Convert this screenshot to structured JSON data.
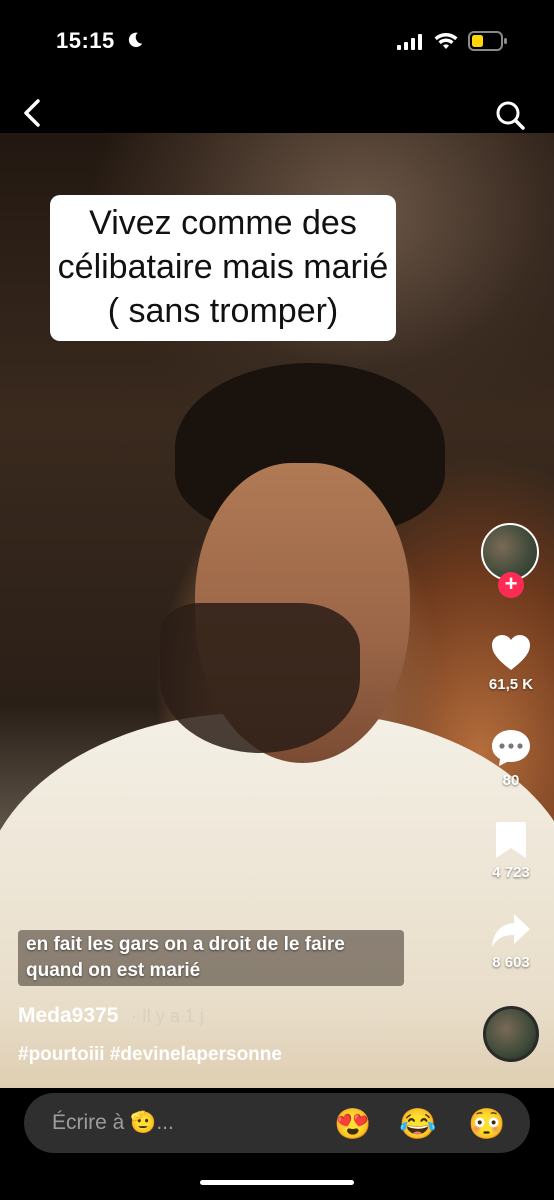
{
  "status": {
    "time": "15:15",
    "moon_icon": "moon-icon",
    "battery_color": "#ffd60a"
  },
  "nav": {
    "back_icon": "back-chevron-icon",
    "search_icon": "search-icon"
  },
  "video": {
    "caption_lines": [
      "Vivez comme des",
      "célibataire mais marié",
      "( sans tromper)"
    ]
  },
  "sidebar": {
    "likes": "61,5 K",
    "comments": "80",
    "saves": "4 723",
    "shares": "8 603",
    "follow_symbol": "+"
  },
  "post": {
    "description_line1": "en fait les gars on a droit de le faire",
    "description_line2": "quand on est marié",
    "author": "Meda9375",
    "time_ago": "· Il y a 1 j",
    "hashtags": "#pourtoiii #devinelapersonne"
  },
  "comment_bar": {
    "placeholder": "Écrire à 🫡...",
    "emojis": [
      "😍",
      "😂",
      "😳"
    ]
  },
  "colors": {
    "accent": "#fe2c55"
  }
}
